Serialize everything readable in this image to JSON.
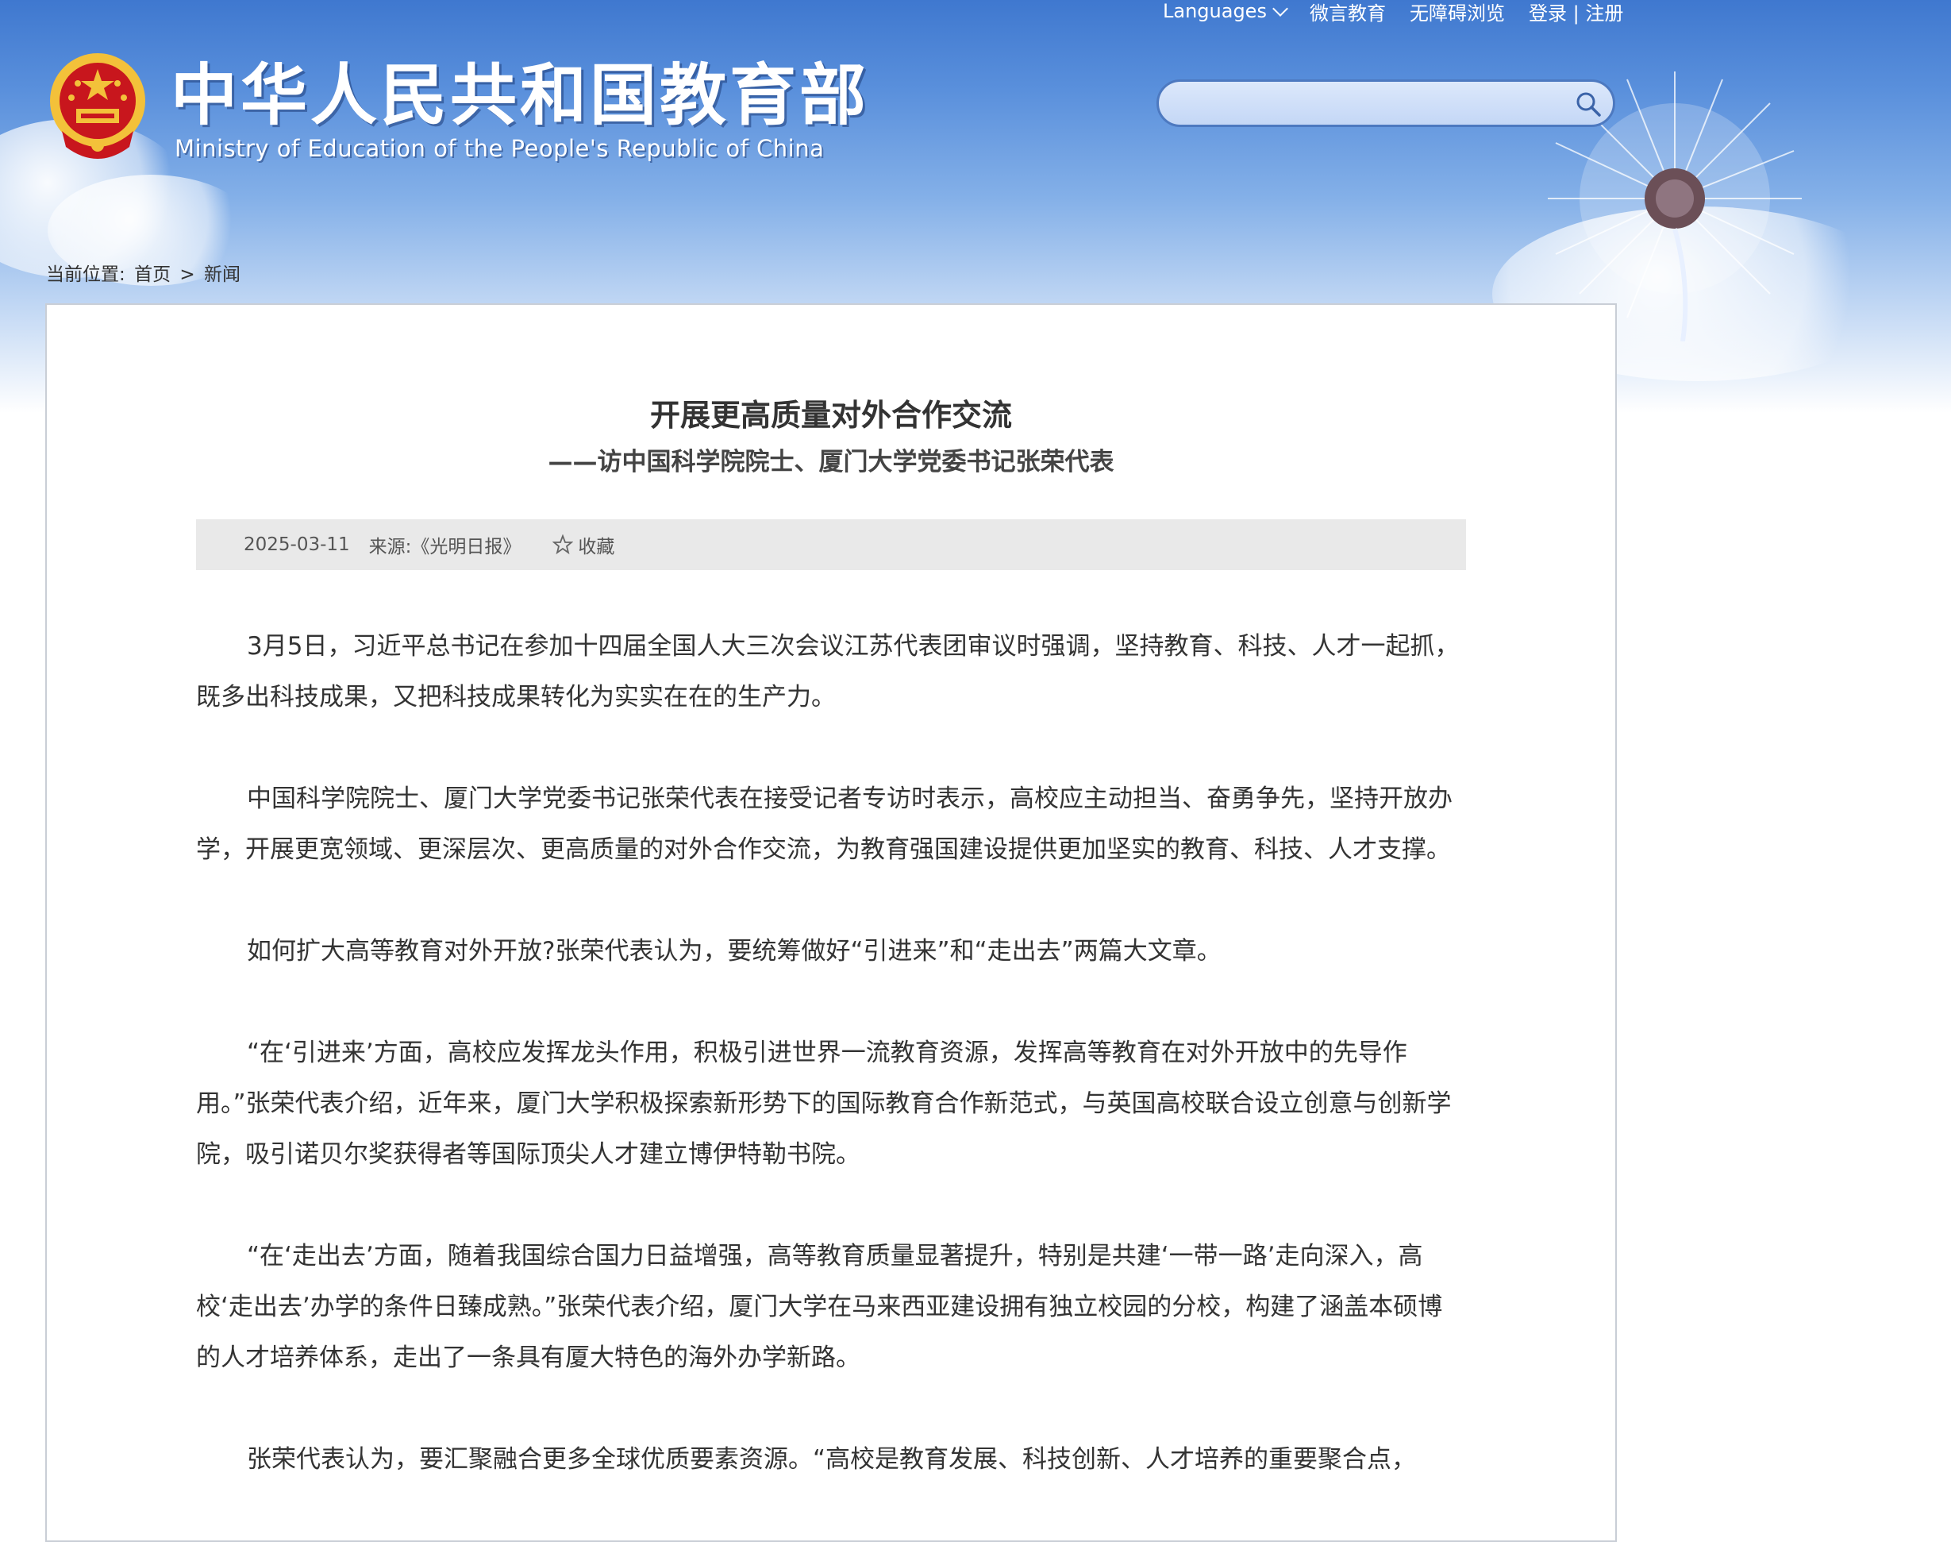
{
  "header": {
    "site_title": "中华人民共和国教育部",
    "site_subtitle": "Ministry of Education of the People's Republic of China",
    "nav": {
      "languages": "Languages",
      "weiyan": "微言教育",
      "accessible": "无障碍浏览",
      "login": "登录",
      "separator": "|",
      "register": "注册"
    },
    "search": {
      "placeholder": "",
      "value": ""
    }
  },
  "breadcrumb": {
    "prefix": "当前位置:",
    "home": "首页",
    "sep": ">",
    "current": "新闻"
  },
  "article": {
    "title": "开展更高质量对外合作交流",
    "subtitle": "——访中国科学院院士、厦门大学党委书记张荣代表",
    "date": "2025-03-11",
    "source": "来源:《光明日报》",
    "favorite": "收藏",
    "paragraphs": [
      "3月5日，习近平总书记在参加十四届全国人大三次会议江苏代表团审议时强调，坚持教育、科技、人才一起抓，既多出科技成果，又把科技成果转化为实实在在的生产力。",
      "中国科学院院士、厦门大学党委书记张荣代表在接受记者专访时表示，高校应主动担当、奋勇争先，坚持开放办学，开展更宽领域、更深层次、更高质量的对外合作交流，为教育强国建设提供更加坚实的教育、科技、人才支撑。",
      "如何扩大高等教育对外开放?张荣代表认为，要统筹做好“引进来”和“走出去”两篇大文章。",
      "“在‘引进来’方面，高校应发挥龙头作用，积极引进世界一流教育资源，发挥高等教育在对外开放中的先导作用。”张荣代表介绍，近年来，厦门大学积极探索新形势下的国际教育合作新范式，与英国高校联合设立创意与创新学院，吸引诺贝尔奖获得者等国际顶尖人才建立博伊特勒书院。",
      "“在‘走出去’方面，随着我国综合国力日益增强，高等教育质量显著提升，特别是共建‘一带一路’走向深入，高校‘走出去’办学的条件日臻成熟。”张荣代表介绍，厦门大学在马来西亚建设拥有独立校园的分校，构建了涵盖本硕博的人才培养体系，走出了一条具有厦大特色的海外办学新路。",
      "张荣代表认为，要汇聚融合更多全球优质要素资源。“高校是教育发展、科技创新、人才培养的重要聚合点，"
    ]
  },
  "colors": {
    "banner_top": "#3f78cf",
    "search_border": "#4d79c0",
    "meta_bg": "#e9e9e9",
    "emblem_red": "#c8161d",
    "emblem_gold": "#f3c13a"
  },
  "icons": {
    "emblem": "national-emblem-icon",
    "search": "search-icon",
    "favorite": "star-icon",
    "languages_dropdown": "chevron-down-icon"
  }
}
